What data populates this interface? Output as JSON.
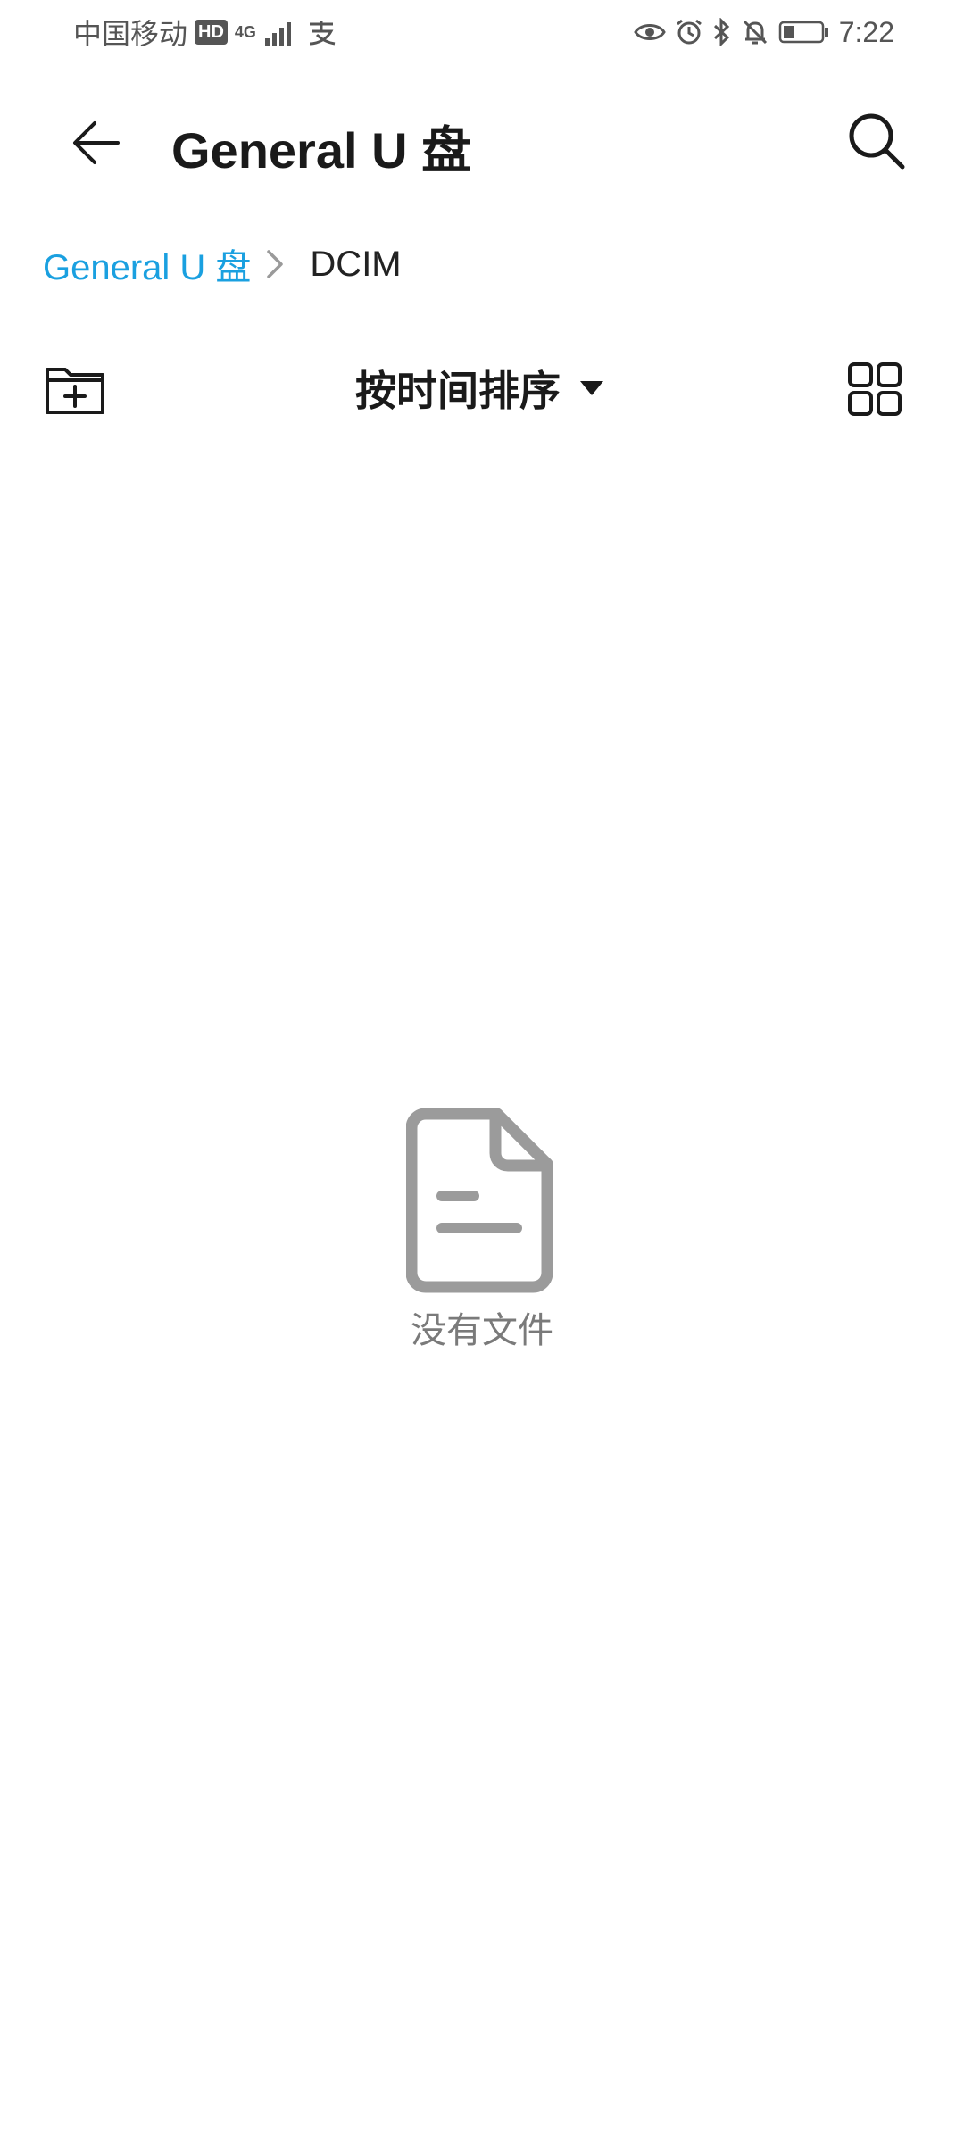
{
  "status_bar": {
    "carrier": "中国移动",
    "hd_badge": "HD",
    "network": "4G",
    "time": "7:22"
  },
  "app_bar": {
    "title": "General U 盘"
  },
  "breadcrumb": {
    "root": "General U 盘",
    "current": "DCIM"
  },
  "toolbar": {
    "sort_label": "按时间排序"
  },
  "empty_state": {
    "message": "没有文件"
  },
  "colors": {
    "accent": "#1aa0e0",
    "icon_gray": "#9b9b9b",
    "text_dark": "#1a1a1a"
  }
}
